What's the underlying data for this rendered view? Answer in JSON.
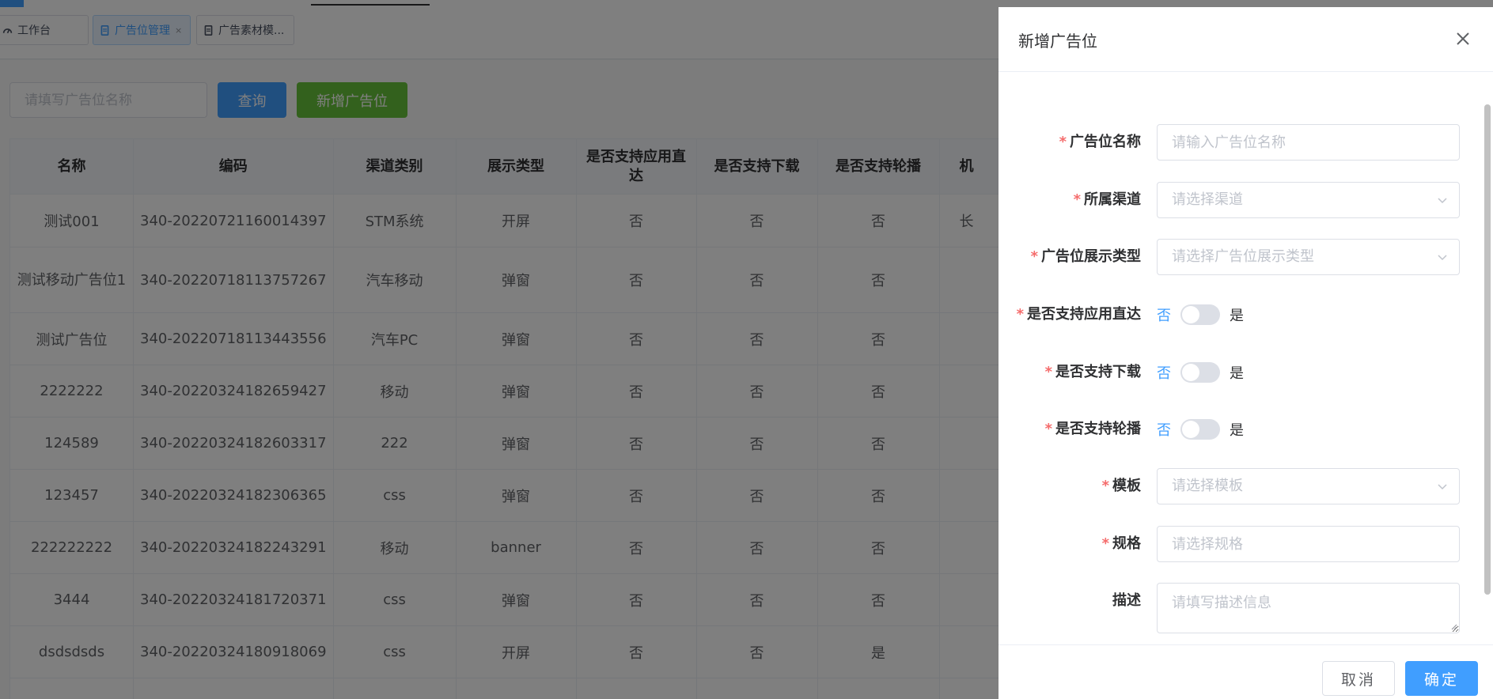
{
  "tags": [
    {
      "label": "工作台",
      "icon": "dashboard-icon",
      "active": false
    },
    {
      "label": "广告位管理",
      "icon": "document-icon",
      "active": true,
      "close": "×"
    },
    {
      "label": "广告素材模...",
      "icon": "document-icon",
      "active": false
    }
  ],
  "search": {
    "placeholder": "请填写广告位名称"
  },
  "buttons": {
    "query": "查询",
    "add": "新增广告位"
  },
  "table": {
    "columns": [
      "名称",
      "编码",
      "渠道类别",
      "展示类型",
      "是否支持应用直达",
      "是否支持下载",
      "是否支持轮播",
      "机"
    ],
    "rows": [
      [
        "测试001",
        "340-20220721160014397",
        "STM系统",
        "开屏",
        "否",
        "否",
        "否",
        "长"
      ],
      [
        "测试移动广告位1",
        "340-20220718113757267",
        "汽车移动",
        "弹窗",
        "否",
        "否",
        "否",
        ""
      ],
      [
        "测试广告位",
        "340-20220718113443556",
        "汽车PC",
        "弹窗",
        "否",
        "否",
        "否",
        ""
      ],
      [
        "2222222",
        "340-20220324182659427",
        "移动",
        "弹窗",
        "否",
        "否",
        "否",
        ""
      ],
      [
        "124589",
        "340-20220324182603317",
        "222",
        "弹窗",
        "否",
        "否",
        "否",
        ""
      ],
      [
        "123457",
        "340-20220324182306365",
        "css",
        "弹窗",
        "否",
        "否",
        "否",
        ""
      ],
      [
        "222222222",
        "340-20220324182243291",
        "移动",
        "banner",
        "否",
        "否",
        "否",
        ""
      ],
      [
        "3444",
        "340-20220324181720371",
        "css",
        "弹窗",
        "否",
        "否",
        "否",
        ""
      ],
      [
        "dsdsdsds",
        "340-20220324180918069",
        "css",
        "开屏",
        "否",
        "否",
        "是",
        ""
      ]
    ]
  },
  "drawer": {
    "title": "新增广告位",
    "required_mark": "*",
    "fields": {
      "name": {
        "label": "广告位名称",
        "placeholder": "请输入广告位名称"
      },
      "channel": {
        "label": "所属渠道",
        "placeholder": "请选择渠道"
      },
      "display_type": {
        "label": "广告位展示类型",
        "placeholder": "请选择广告位展示类型"
      },
      "direct": {
        "label": "是否支持应用直达",
        "off": "否",
        "on": "是",
        "value": false
      },
      "download": {
        "label": "是否支持下载",
        "off": "否",
        "on": "是",
        "value": false
      },
      "carousel": {
        "label": "是否支持轮播",
        "off": "否",
        "on": "是",
        "value": false
      },
      "template": {
        "label": "模板",
        "placeholder": "请选择模板"
      },
      "spec": {
        "label": "规格",
        "placeholder": "请选择规格"
      },
      "desc": {
        "label": "描述",
        "placeholder": "请填写描述信息"
      }
    },
    "cancel": "取消",
    "confirm": "确定"
  },
  "colors": {
    "primary": "#409eff",
    "success": "#67c23a",
    "danger": "#f56c6c"
  }
}
